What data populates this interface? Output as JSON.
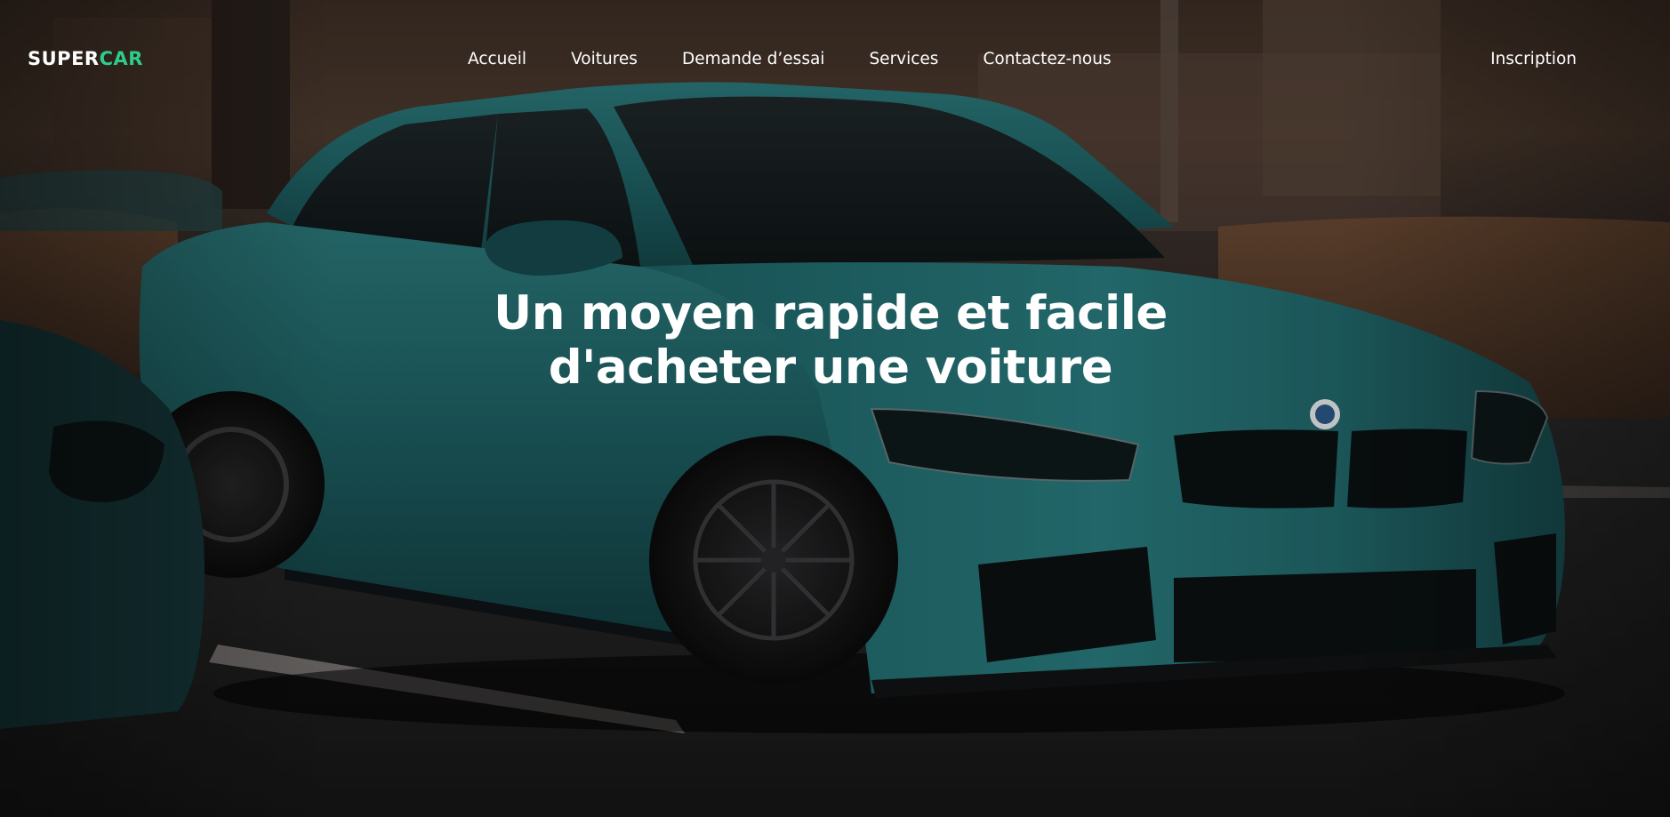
{
  "brand": {
    "logo_part1": "SUPER",
    "logo_part2": "CAR",
    "accent_color": "#2ecc8a"
  },
  "nav": {
    "items": [
      {
        "label": "Accueil"
      },
      {
        "label": "Voitures"
      },
      {
        "label": "Demande d’essai"
      },
      {
        "label": "Services"
      },
      {
        "label": "Contactez-nous"
      }
    ],
    "signup_label": "Inscription"
  },
  "hero": {
    "headline_line1": "Un moyen rapide et facile",
    "headline_line2": "d'acheter une voiture",
    "background_subject": "teal-sports-sedan-photo"
  }
}
